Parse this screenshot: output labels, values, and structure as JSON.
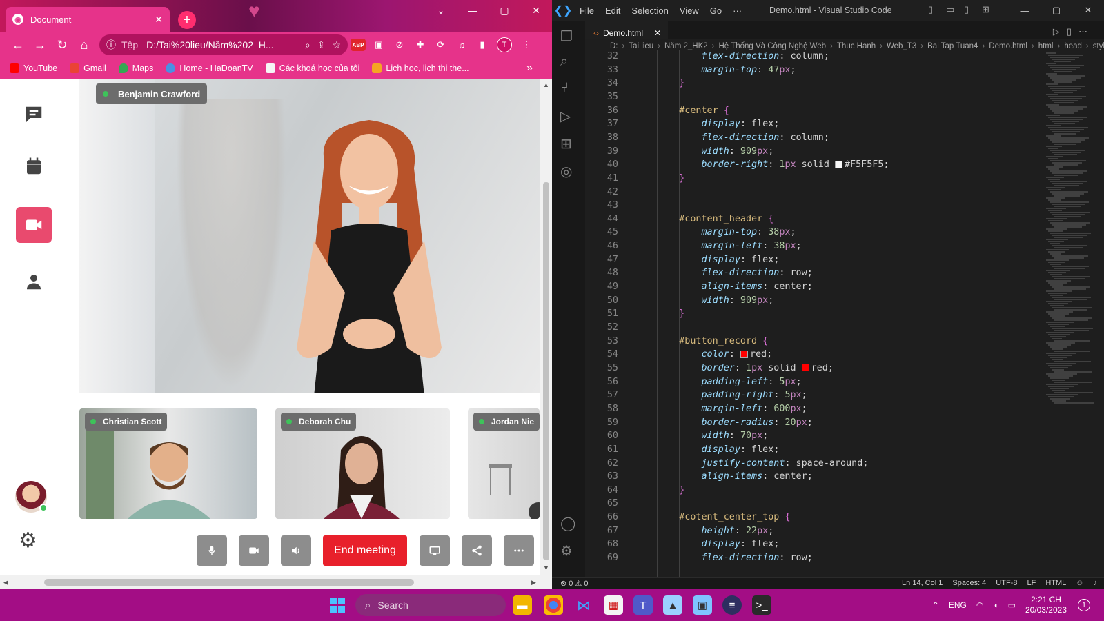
{
  "chrome": {
    "tab_title": "Document",
    "tab_close": "✕",
    "new_tab": "+",
    "window_buttons": [
      "⌄",
      "—",
      "▢",
      "✕"
    ],
    "url_scheme": "Tệp",
    "url": "D:/Tai%20lieu/Năm%202_H...",
    "bookmarks": [
      "YouTube",
      "Gmail",
      "Maps",
      "Home - HaDoanTV",
      "Các khoá học của tôi",
      "Lịch học, lịch thi the..."
    ],
    "bookmark_colors": [
      "#ff0000",
      "#ea4335",
      "#34a853",
      "#4a90e2",
      "#f5f5f5",
      "#f5a623"
    ],
    "profile_initial": "T",
    "ext_abp": "ABP"
  },
  "meeting": {
    "main_speaker": "Benjamin Crawford",
    "participants": [
      "Christian Scott",
      "Deborah Chu",
      "Jordan Nie"
    ],
    "end_meeting_label": "End meeting",
    "accent_color": "#e94a6e",
    "end_color": "#e8202b"
  },
  "vscode": {
    "menus": [
      "File",
      "Edit",
      "Selection",
      "View",
      "Go",
      "···"
    ],
    "window_title": "Demo.html - Visual Studio Code",
    "tab_name": "Demo.html",
    "breadcrumb": [
      "D:",
      "Tai lieu",
      "Năm 2_HK2",
      "Hệ Thống Và Công Nghệ Web",
      "Thuc Hanh",
      "Web_T3",
      "Bai Tap Tuan4",
      "Demo.html",
      "html",
      "head",
      "style"
    ],
    "status_left": "⊗ 0 ⚠ 0",
    "status_right": [
      "Ln 14, Col 1",
      "Spaces: 4",
      "UTF-8",
      "LF",
      "HTML"
    ]
  },
  "code_lines": [
    {
      "n": "32",
      "t": "        flex-direction: column;"
    },
    {
      "n": "33",
      "t": "        margin-top: 47px;"
    },
    {
      "n": "34",
      "t": "    }"
    },
    {
      "n": "35",
      "t": ""
    },
    {
      "n": "36",
      "t": "    #center {"
    },
    {
      "n": "37",
      "t": "        display: flex;"
    },
    {
      "n": "38",
      "t": "        flex-direction: column;"
    },
    {
      "n": "39",
      "t": "        width: 909px;"
    },
    {
      "n": "40",
      "t": "        border-right: 1px solid #F5F5F5;"
    },
    {
      "n": "41",
      "t": "    }"
    },
    {
      "n": "42",
      "t": ""
    },
    {
      "n": "43",
      "t": ""
    },
    {
      "n": "44",
      "t": "    #content_header {"
    },
    {
      "n": "45",
      "t": "        margin-top: 38px;"
    },
    {
      "n": "46",
      "t": "        margin-left: 38px;"
    },
    {
      "n": "47",
      "t": "        display: flex;"
    },
    {
      "n": "48",
      "t": "        flex-direction: row;"
    },
    {
      "n": "49",
      "t": "        align-items: center;"
    },
    {
      "n": "50",
      "t": "        width: 909px;"
    },
    {
      "n": "51",
      "t": "    }"
    },
    {
      "n": "52",
      "t": ""
    },
    {
      "n": "53",
      "t": "    #button_record {"
    },
    {
      "n": "54",
      "t": "        color: red;"
    },
    {
      "n": "55",
      "t": "        border: 1px solid red;"
    },
    {
      "n": "56",
      "t": "        padding-left: 5px;"
    },
    {
      "n": "57",
      "t": "        padding-right: 5px;"
    },
    {
      "n": "58",
      "t": "        margin-left: 600px;"
    },
    {
      "n": "59",
      "t": "        border-radius: 20px;"
    },
    {
      "n": "60",
      "t": "        width: 70px;"
    },
    {
      "n": "61",
      "t": "        display: flex;"
    },
    {
      "n": "62",
      "t": "        justify-content: space-around;"
    },
    {
      "n": "63",
      "t": "        align-items: center;"
    },
    {
      "n": "64",
      "t": "    }"
    },
    {
      "n": "65",
      "t": ""
    },
    {
      "n": "66",
      "t": "    #cotent_center_top {"
    },
    {
      "n": "67",
      "t": "        height: 22px;"
    },
    {
      "n": "68",
      "t": "        display: flex;"
    },
    {
      "n": "69",
      "t": "        flex-direction: row;"
    }
  ],
  "taskbar": {
    "search_placeholder": "Search",
    "language": "ENG",
    "time": "2:21 CH",
    "date": "20/03/2023",
    "notifications": "1",
    "color": "#a30d85"
  }
}
